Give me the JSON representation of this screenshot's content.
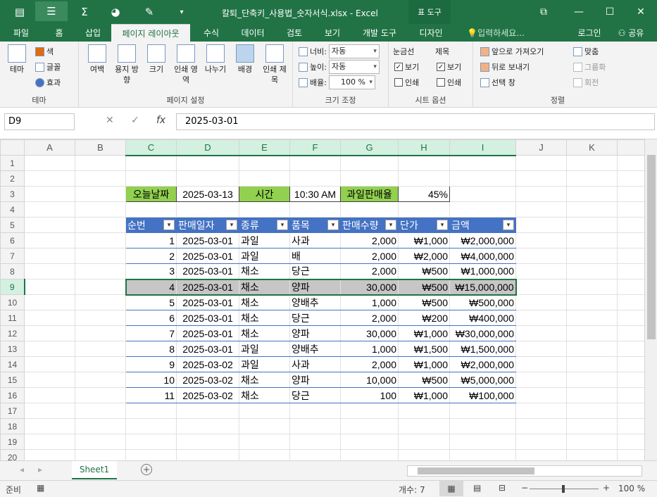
{
  "window": {
    "title": "칼퇴_단축키_사용법_숫자서식.xlsx - Excel",
    "context_tab": "표 도구"
  },
  "tabs": [
    "파일",
    "홈",
    "삽입",
    "페이지 레이아웃",
    "수식",
    "데이터",
    "검토",
    "보기",
    "개발 도구",
    "디자인"
  ],
  "tell_me": "입력하세요...",
  "login": "로그인",
  "share": "공유",
  "ribbon": {
    "theme": {
      "big": "테마",
      "color": "색",
      "font": "글꼴",
      "effect": "효과",
      "group": "테마"
    },
    "page_setup": {
      "margin": "여백",
      "orientation": "용지 방향",
      "size": "크기",
      "print_area": "인쇄 영역",
      "breaks": "나누기",
      "background": "배경",
      "print_titles": "인쇄 제목",
      "group": "페이지 설정"
    },
    "scale": {
      "width_label": "너비:",
      "width_val": "자동",
      "height_label": "높이:",
      "height_val": "자동",
      "scale_label": "배율:",
      "scale_val": "100 %",
      "group": "크기 조정"
    },
    "sheet_opts": {
      "gridlines": "눈금선",
      "headings": "제목",
      "view": "보기",
      "print": "인쇄",
      "group": "시트 옵션"
    },
    "arrange": {
      "forward": "앞으로 가져오기",
      "backward": "뒤로 보내기",
      "selection": "선택 창",
      "align": "맞춤",
      "group_btn": "그룹화",
      "rotate": "회전",
      "group": "정렬"
    }
  },
  "formula": {
    "name_box": "D9",
    "value": "2025-03-01"
  },
  "columns": [
    "A",
    "B",
    "C",
    "D",
    "E",
    "F",
    "G",
    "H",
    "I",
    "J",
    "K"
  ],
  "rows": [
    "1",
    "2",
    "3",
    "4",
    "5",
    "6",
    "7",
    "8",
    "9",
    "10",
    "11",
    "12",
    "13",
    "14",
    "15",
    "16",
    "17",
    "18",
    "19",
    "20"
  ],
  "summary": {
    "today_label": "오늘날짜",
    "today_val": "2025-03-13",
    "time_label": "시간",
    "time_val": "10:30 AM",
    "fruit_label": "과일판매율",
    "fruit_val": "45%"
  },
  "table": {
    "headers": [
      "순번",
      "판매일자",
      "종류",
      "품목",
      "판매수량",
      "단가",
      "금액"
    ],
    "rows": [
      [
        "1",
        "2025-03-01",
        "과일",
        "사과",
        "2,000",
        "₩1,000",
        "₩2,000,000"
      ],
      [
        "2",
        "2025-03-01",
        "과일",
        "배",
        "2,000",
        "₩2,000",
        "₩4,000,000"
      ],
      [
        "3",
        "2025-03-01",
        "채소",
        "당근",
        "2,000",
        "₩500",
        "₩1,000,000"
      ],
      [
        "4",
        "2025-03-01",
        "채소",
        "양파",
        "30,000",
        "₩500",
        "₩15,000,000"
      ],
      [
        "5",
        "2025-03-01",
        "채소",
        "양배추",
        "1,000",
        "₩500",
        "₩500,000"
      ],
      [
        "6",
        "2025-03-01",
        "채소",
        "당근",
        "2,000",
        "₩200",
        "₩400,000"
      ],
      [
        "7",
        "2025-03-01",
        "채소",
        "양파",
        "30,000",
        "₩1,000",
        "₩30,000,000"
      ],
      [
        "8",
        "2025-03-01",
        "과일",
        "양배추",
        "1,000",
        "₩1,500",
        "₩1,500,000"
      ],
      [
        "9",
        "2025-03-02",
        "과일",
        "사과",
        "2,000",
        "₩1,000",
        "₩2,000,000"
      ],
      [
        "10",
        "2025-03-02",
        "채소",
        "양파",
        "10,000",
        "₩500",
        "₩5,000,000"
      ],
      [
        "11",
        "2025-03-02",
        "채소",
        "당근",
        "100",
        "₩1,000",
        "₩100,000"
      ]
    ]
  },
  "sheet_tab": "Sheet1",
  "status": {
    "ready": "준비",
    "count": "개수: 7",
    "zoom": "100 %"
  }
}
